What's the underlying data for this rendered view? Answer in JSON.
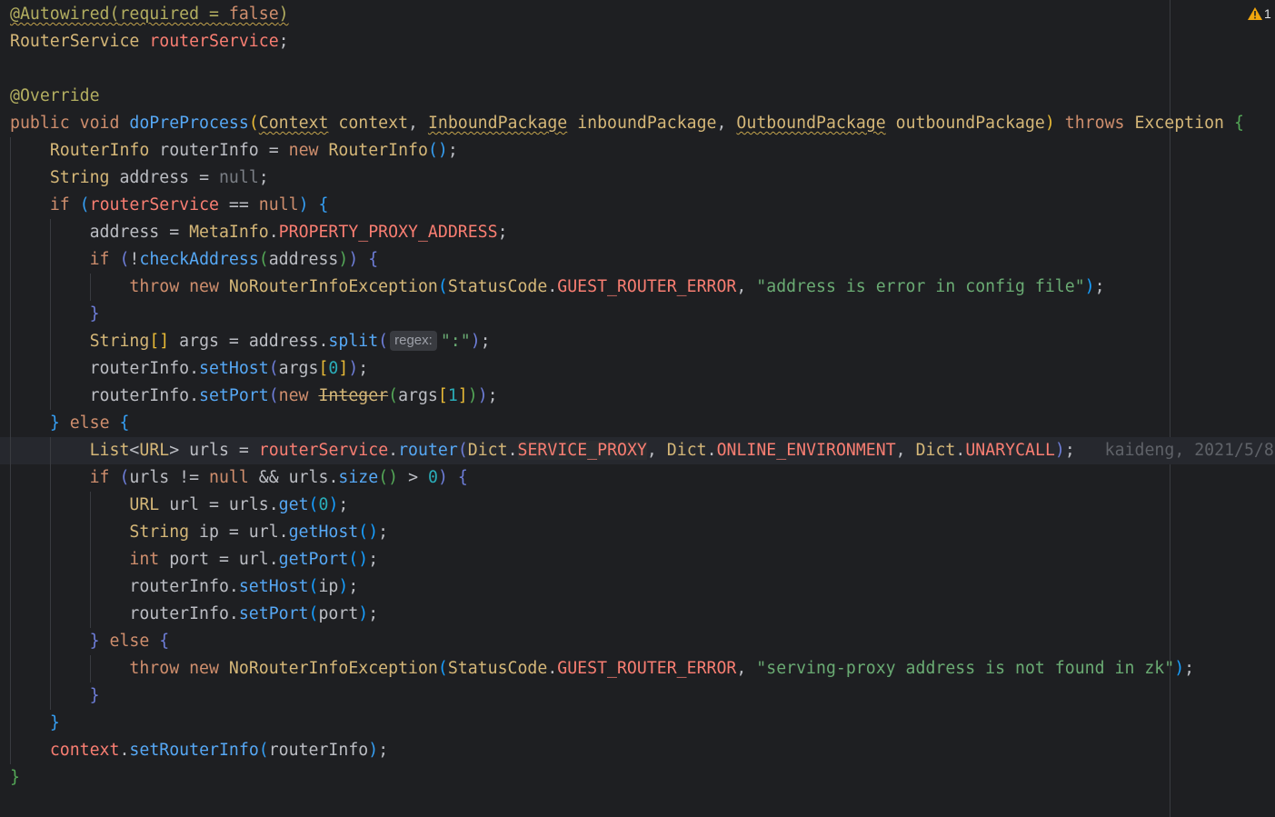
{
  "editor": {
    "warning_count": "1",
    "blame": "kaideng, 2021/5/8",
    "param_hint": "regex:"
  },
  "lines": [
    "@Autowired(required = false)",
    "RouterService routerService;",
    "",
    "@Override",
    "public void doPreProcess(Context context, InboundPackage inboundPackage, OutboundPackage outboundPackage) throws Exception {",
    "    RouterInfo routerInfo = new RouterInfo();",
    "    String address = null;",
    "    if (routerService == null) {",
    "        address = MetaInfo.PROPERTY_PROXY_ADDRESS;",
    "        if (!checkAddress(address)) {",
    "            throw new NoRouterInfoException(StatusCode.GUEST_ROUTER_ERROR, \"address is error in config file\");",
    "        }",
    "        String[] args = address.split(\":\");",
    "        routerInfo.setHost(args[0]);",
    "        routerInfo.setPort(new Integer(args[1]));",
    "    } else {",
    "        List<URL> urls = routerService.router(Dict.SERVICE_PROXY, Dict.ONLINE_ENVIRONMENT, Dict.UNARYCALL);",
    "        if (urls != null && urls.size() > 0) {",
    "            URL url = urls.get(0);",
    "            String ip = url.getHost();",
    "            int port = url.getPort();",
    "            routerInfo.setHost(ip);",
    "            routerInfo.setPort(port);",
    "        } else {",
    "            throw new NoRouterInfoException(StatusCode.GUEST_ROUTER_ERROR, \"serving-proxy address is not found in zk\");",
    "        }",
    "    }",
    "    context.setRouterInfo(routerInfo);",
    "}"
  ]
}
